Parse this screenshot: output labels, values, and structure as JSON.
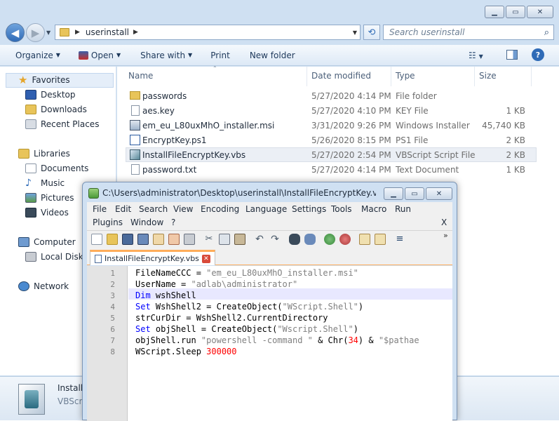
{
  "explorer": {
    "address": {
      "crumb": "userinstall"
    },
    "search": {
      "placeholder": "Search userinstall"
    },
    "toolbar": {
      "organize": "Organize",
      "open": "Open",
      "share_with": "Share with",
      "print": "Print",
      "new_folder": "New folder"
    },
    "nav": {
      "favorites": "Favorites",
      "desktop": "Desktop",
      "downloads": "Downloads",
      "recent_places": "Recent Places",
      "libraries": "Libraries",
      "documents": "Documents",
      "music": "Music",
      "pictures": "Pictures",
      "videos": "Videos",
      "computer": "Computer",
      "local_disk": "Local Disk (C",
      "network": "Network"
    },
    "columns": {
      "name": "Name",
      "date": "Date modified",
      "type": "Type",
      "size": "Size"
    },
    "files": [
      {
        "name": "passwords",
        "date": "5/27/2020 4:14 PM",
        "type": "File folder",
        "size": ""
      },
      {
        "name": "aes.key",
        "date": "5/27/2020 4:10 PM",
        "type": "KEY File",
        "size": "1 KB"
      },
      {
        "name": "em_eu_L80uxMhO_installer.msi",
        "date": "3/31/2020 9:26 PM",
        "type": "Windows Installer ...",
        "size": "45,740 KB"
      },
      {
        "name": "EncryptKey.ps1",
        "date": "5/26/2020 8:15 PM",
        "type": "PS1 File",
        "size": "2 KB"
      },
      {
        "name": "InstallFileEncryptKey.vbs",
        "date": "5/27/2020 2:54 PM",
        "type": "VBScript Script File",
        "size": "2 KB"
      },
      {
        "name": "password.txt",
        "date": "5/27/2020 4:14 PM",
        "type": "Text Document",
        "size": "1 KB"
      }
    ],
    "details": {
      "name": "Install",
      "type": "VBScri"
    }
  },
  "npp": {
    "title": "C:\\Users\\administrator\\Desktop\\userinstall\\InstallFileEncryptKey.vbs - N...",
    "menu": {
      "file": "File",
      "edit": "Edit",
      "search": "Search",
      "view": "View",
      "encoding": "Encoding",
      "language": "Language",
      "settings": "Settings",
      "tools": "Tools",
      "macro": "Macro",
      "run": "Run",
      "plugins": "Plugins",
      "window": "Window",
      "help": "?",
      "close": "X"
    },
    "tab": "InstallFileEncryptKey.vbs",
    "line_numbers": [
      "1",
      "2",
      "3",
      "4",
      "5",
      "6",
      "7",
      "8"
    ],
    "code": {
      "l1a": "FileNameCCC = ",
      "l1b": "\"em_eu_L80uxMhO_installer.msi\"",
      "l2a": "UserName = ",
      "l2b": "\"adlab\\administrator\"",
      "l3a": "Dim",
      "l3b": " wshShell",
      "l4a": "Set",
      "l4b": " WshShell2 = CreateObject(",
      "l4c": "\"WScript.Shell\"",
      "l4d": ")",
      "l5": "strCurDir = WshShell2.CurrentDirectory",
      "l6a": "Set",
      "l6b": " objShell = CreateObject(",
      "l6c": "\"Wscript.Shell\"",
      "l6d": ")",
      "l7a": "objShell.run ",
      "l7b": "\"powershell -command \"",
      "l7c": " & Chr(",
      "l7d": "34",
      "l7e": ") & ",
      "l7f": "\"$pathae",
      "l8a": "WScript.Sleep ",
      "l8b": "300000"
    }
  }
}
